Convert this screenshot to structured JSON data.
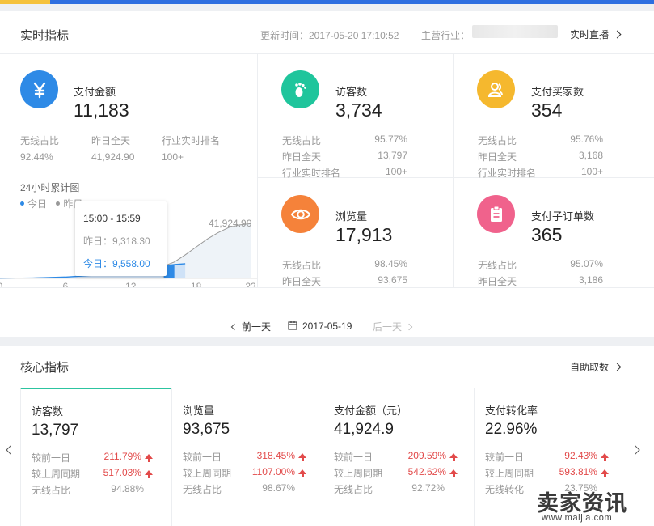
{
  "realtime": {
    "title": "实时指标",
    "update_label": "更新时间：2017-05-20 17:10:52",
    "industry_label": "主营行业：",
    "live_link": "实时直播",
    "pay_amount": {
      "label": "支付金额",
      "value": "11,183",
      "icon": "yen-icon",
      "color": "#2e8ae6",
      "stats": [
        {
          "label": "无线占比",
          "value": "92.44%"
        },
        {
          "label": "昨日全天",
          "value": "41,924.90"
        },
        {
          "label": "行业实时排名",
          "value": "100+"
        }
      ]
    },
    "visitors": {
      "label": "访客数",
      "value": "3,734",
      "icon": "footprint-icon",
      "color": "#1fc59c",
      "stats": [
        {
          "label": "无线占比",
          "value": "95.77%"
        },
        {
          "label": "昨日全天",
          "value": "13,797"
        },
        {
          "label": "行业实时排名",
          "value": "100+"
        }
      ]
    },
    "buyers": {
      "label": "支付买家数",
      "value": "354",
      "icon": "user-icon",
      "color": "#f5b82e",
      "stats": [
        {
          "label": "无线占比",
          "value": "95.76%"
        },
        {
          "label": "昨日全天",
          "value": "3,168"
        },
        {
          "label": "行业实时排名",
          "value": "100+"
        }
      ]
    },
    "pageviews": {
      "label": "浏览量",
      "value": "17,913",
      "icon": "eye-icon",
      "color": "#f5823a",
      "stats": [
        {
          "label": "无线占比",
          "value": "98.45%"
        },
        {
          "label": "昨日全天",
          "value": "93,675"
        }
      ]
    },
    "suborders": {
      "label": "支付子订单数",
      "value": "365",
      "icon": "clipboard-icon",
      "color": "#f0628c",
      "stats": [
        {
          "label": "无线占比",
          "value": "95.07%"
        },
        {
          "label": "昨日全天",
          "value": "3,186"
        }
      ]
    },
    "chart": {
      "title": "24小时累计图",
      "legend_today": "今日",
      "legend_yesterday": "昨日",
      "peak_label": "41,924.90",
      "tooltip_time": "15:00 - 15:59",
      "tooltip_yesterday": "昨日：9,318.30",
      "tooltip_today": "今日：9,558.00"
    },
    "day_nav": {
      "prev": "前一天",
      "date": "2017-05-19",
      "next": "后一天"
    }
  },
  "chart_data": {
    "type": "area",
    "title": "24小时累计图",
    "x_ticks": [
      "0",
      "6",
      "12",
      "18",
      "23"
    ],
    "xlim": [
      0,
      23
    ],
    "series": [
      {
        "name": "昨日",
        "x": [
          0,
          3,
          6,
          9,
          12,
          15,
          16,
          17,
          18,
          19,
          20,
          21,
          22,
          23
        ],
        "values": [
          0,
          300,
          900,
          2500,
          5500,
          9318.3,
          12500,
          18000,
          24000,
          30000,
          35000,
          39000,
          41000,
          41924.9
        ],
        "color": "#999999"
      },
      {
        "name": "今日",
        "x": [
          0,
          3,
          6,
          9,
          12,
          15,
          16,
          17
        ],
        "values": [
          0,
          300,
          1000,
          2700,
          5800,
          9558,
          10600,
          11183
        ],
        "color": "#2e8ae6"
      }
    ],
    "ylim": [
      0,
      44000
    ],
    "highlight_hour": 15
  },
  "core": {
    "title": "核心指标",
    "link": "自助取数",
    "cards": [
      {
        "label": "访客数",
        "value": "13,797",
        "r1_label": "较前一日",
        "r1_value": "211.79%",
        "r2_label": "较上周同期",
        "r2_value": "517.03%",
        "r3_label": "无线占比",
        "r3_value": "94.88%"
      },
      {
        "label": "浏览量",
        "value": "93,675",
        "r1_label": "较前一日",
        "r1_value": "318.45%",
        "r2_label": "较上周同期",
        "r2_value": "1107.00%",
        "r3_label": "无线占比",
        "r3_value": "98.67%"
      },
      {
        "label": "支付金额（元）",
        "value": "41,924.9",
        "r1_label": "较前一日",
        "r1_value": "209.59%",
        "r2_label": "较上周同期",
        "r2_value": "542.62%",
        "r3_label": "无线占比",
        "r3_value": "92.72%"
      },
      {
        "label": "支付转化率",
        "value": "22.96%",
        "r1_label": "较前一日",
        "r1_value": "92.43%",
        "r2_label": "较上周同期",
        "r2_value": "593.81%",
        "r3_label": "无线转化",
        "r3_value": "23.75%"
      }
    ]
  },
  "watermark": {
    "big": "卖家资讯",
    "small": "www.maijia.com"
  }
}
